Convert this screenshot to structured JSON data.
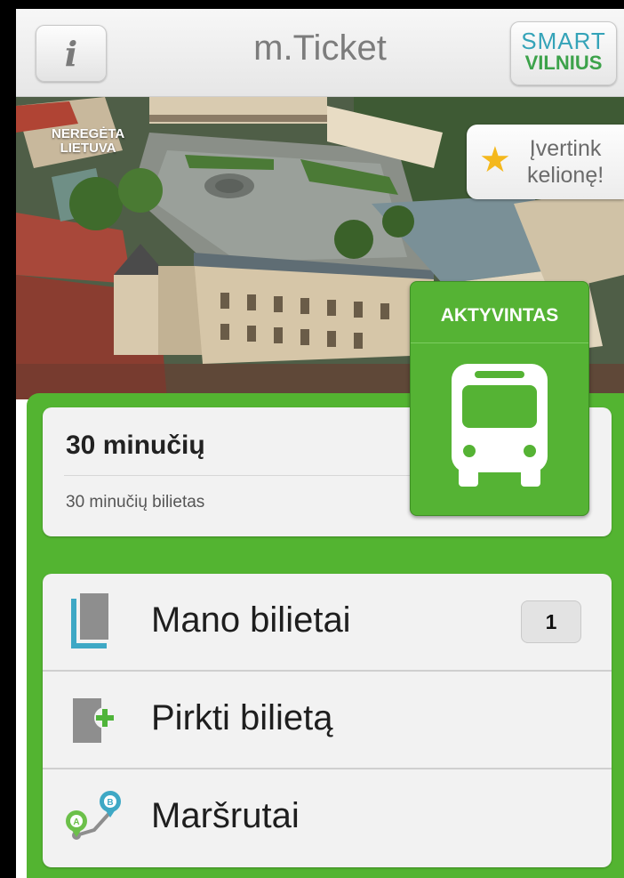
{
  "header": {
    "title": "m.Ticket",
    "info_label": "i",
    "logo_line1": "SMART",
    "logo_line2": "VILNIUS"
  },
  "photo": {
    "watermark_line1": "NEREGĖTA",
    "watermark_line2": "LIETUVA"
  },
  "rate_trip": {
    "line1": "Įvertink",
    "line2": "kelionę!"
  },
  "ticket": {
    "name": "30 minučių",
    "description": "30 minučių bilietas",
    "status": "AKTYVINTAS"
  },
  "menu": {
    "items": [
      {
        "label": "Mano bilietai",
        "icon": "tickets-icon",
        "badge": "1"
      },
      {
        "label": "Pirkti bilietą",
        "icon": "buy-ticket-icon"
      },
      {
        "label": "Maršrutai",
        "icon": "route-icon"
      }
    ]
  },
  "colors": {
    "accent_green": "#53b431",
    "logo_blue": "#34a3b8",
    "star_yellow": "#f4b81d"
  }
}
